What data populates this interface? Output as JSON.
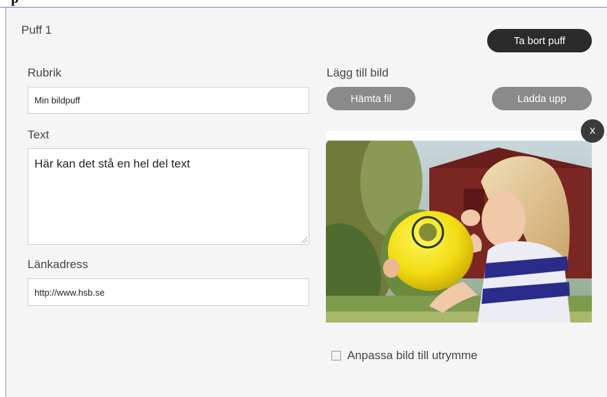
{
  "header": {
    "title": "p"
  },
  "puff": {
    "title": "Puff 1",
    "remove_label": "Ta bort puff"
  },
  "form": {
    "heading_label": "Rubrik",
    "heading_value": "Min bildpuff",
    "text_label": "Text",
    "text_value": "Här kan det stå en hel del text",
    "link_label": "Länkadress",
    "link_value": "http://www.hsb.se"
  },
  "image": {
    "add_label": "Lägg till bild",
    "fetch_label": "Hämta fil",
    "upload_label": "Ladda upp",
    "close_label": "x",
    "fit_label": "Anpassa bild till utrymme",
    "fit_checked": false
  },
  "colors": {
    "panel_bg": "#f5f5f5",
    "dark_button": "#2b2b2b",
    "grey_button": "#8a8a8a",
    "balloon": "#f2e21a",
    "stripe_blue": "#2b2b8a"
  }
}
